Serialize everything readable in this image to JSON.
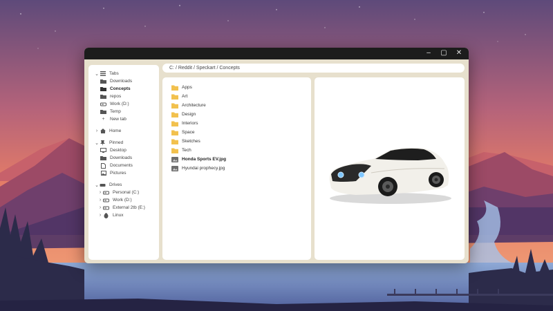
{
  "window": {
    "controls": {
      "minimize": "–",
      "maximize": "▢",
      "close": "✕"
    }
  },
  "address_bar": {
    "path": "C: / Reddit / Speckart / Concepts"
  },
  "sidebar": {
    "tabs": {
      "label": "Tabs",
      "items": [
        {
          "label": "Downloads",
          "icon": "folder-icon"
        },
        {
          "label": "Concepts",
          "icon": "folder-icon",
          "active": true
        },
        {
          "label": "repos",
          "icon": "folder-icon"
        },
        {
          "label": "Work (D:)",
          "icon": "drive-icon"
        },
        {
          "label": "Temp",
          "icon": "folder-icon"
        },
        {
          "label": "New tab",
          "icon": "plus-icon"
        }
      ]
    },
    "home": {
      "label": "Home"
    },
    "pinned": {
      "label": "Pinned",
      "items": [
        {
          "label": "Desktop",
          "icon": "desktop-icon"
        },
        {
          "label": "Downloads",
          "icon": "folder-icon"
        },
        {
          "label": "Documents",
          "icon": "document-icon"
        },
        {
          "label": "Pictures",
          "icon": "picture-icon"
        }
      ]
    },
    "drives": {
      "label": "Drives",
      "items": [
        {
          "label": "Personal (C:)",
          "icon": "drive-icon"
        },
        {
          "label": "Work (D:)",
          "icon": "drive-icon"
        },
        {
          "label": "External 2tb (E:)",
          "icon": "drive-icon"
        },
        {
          "label": "Linux",
          "icon": "linux-icon"
        }
      ]
    }
  },
  "files": [
    {
      "name": "Apps",
      "type": "folder"
    },
    {
      "name": "Art",
      "type": "folder"
    },
    {
      "name": "Architecture",
      "type": "folder"
    },
    {
      "name": "Design",
      "type": "folder"
    },
    {
      "name": "Interiors",
      "type": "folder"
    },
    {
      "name": "Space",
      "type": "folder"
    },
    {
      "name": "Sketches",
      "type": "folder"
    },
    {
      "name": "Tech",
      "type": "folder"
    },
    {
      "name": "Honda Sports EV.jpg",
      "type": "image",
      "selected": true
    },
    {
      "name": "Hyundai prophecy.jpg",
      "type": "image"
    }
  ],
  "colors": {
    "window_bg": "#e7e0cd",
    "titlebar": "#1c1c1c",
    "folder": "#f2c14e",
    "pane": "#ffffff"
  }
}
